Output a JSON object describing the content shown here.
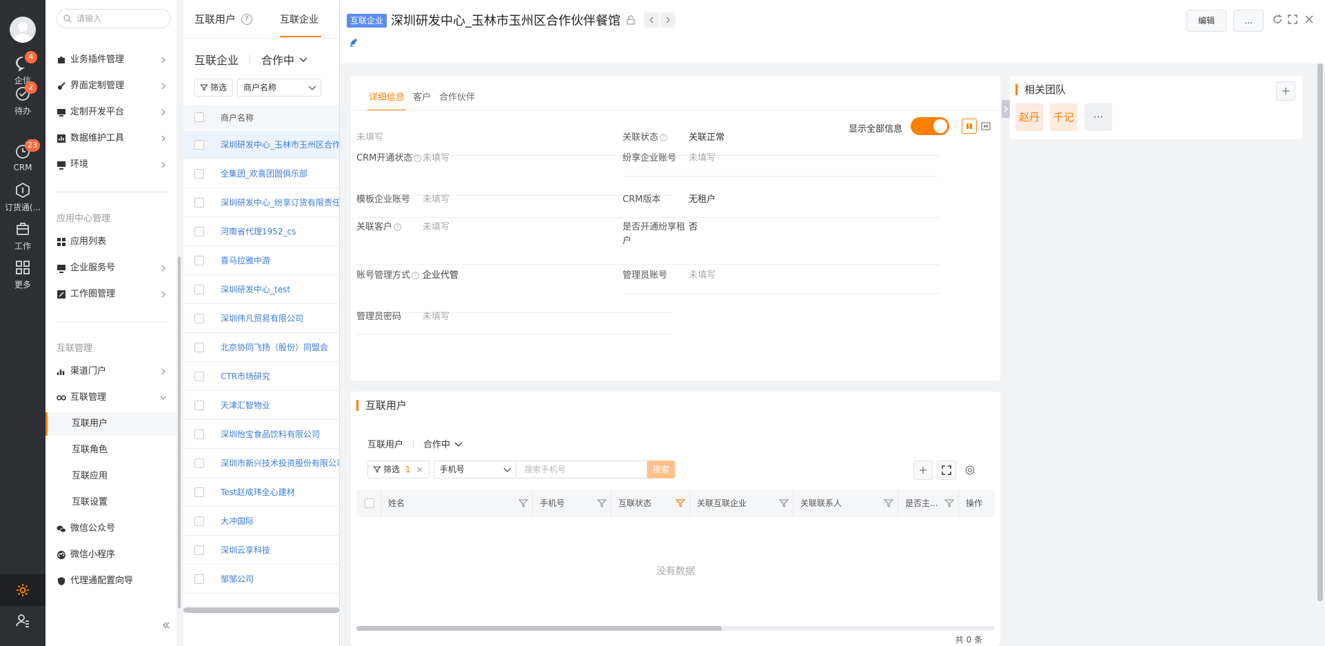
{
  "rail": {
    "items": [
      {
        "label": "企信",
        "badge": "4",
        "icon": "chat-bubble-icon"
      },
      {
        "label": "待办",
        "badge": "2",
        "icon": "check-circle-icon"
      },
      {
        "label": "CRM",
        "badge": "23",
        "icon": "clock-icon"
      },
      {
        "label": "订货通(...",
        "badge": "",
        "icon": "order-box-icon"
      },
      {
        "label": "工作",
        "badge": "",
        "icon": "briefcase-icon"
      },
      {
        "label": "更多",
        "badge": "",
        "icon": "grid-icon"
      }
    ]
  },
  "menu": {
    "search_placeholder": "请输入",
    "group1": [
      "业务插件管理",
      "界面定制管理",
      "定制开发平台",
      "数据维护工具",
      "环境"
    ],
    "section_app": "应用中心管理",
    "group2": [
      "应用列表",
      "企业服务号",
      "工作圈管理"
    ],
    "section_link": "互联管理",
    "channel_portal": "渠道门户",
    "link_mgmt": "互联管理",
    "link_sub": [
      "互联用户",
      "互联角色",
      "互联应用",
      "互联设置"
    ],
    "group3": [
      "微信公众号",
      "微信小程序",
      "代理通配置向导"
    ]
  },
  "list": {
    "tab_users": "互联用户",
    "tab_help": "?",
    "tab_enterprise": "互联企业",
    "scope_object": "互联企业",
    "scope_status": "合作中",
    "filter_label": "筛选",
    "filter_field": "商户名称",
    "col_name": "商户名称",
    "rows": [
      "深圳研发中心_玉林市玉州区合作伙伴餐馆",
      "全集团_欢喜团圆俱乐部",
      "深圳研发中心_纷享订货有限责任公司",
      "河南省代理1952_cs",
      "喜马拉雅中游",
      "深圳研发中心_test",
      "深圳伟凡贸易有限公司",
      "北京协同飞扬（股份）同盟会",
      "CTR市场研究",
      "天津汇智物业",
      "深圳怡宝食品饮料有限公司",
      "深圳市新兴技术投资股份有限公司",
      "Test赵成玮全心建材",
      "大冲国际",
      "深圳云享科技",
      "邹邹公司"
    ]
  },
  "detail": {
    "tag": "互联企业",
    "title": "深圳研发中心_玉林市玉州区合作伙伴餐馆",
    "edit_label": "编辑",
    "more_label": "...",
    "tabs": [
      "详细信息",
      "客户",
      "合作伙伴"
    ],
    "show_all_label": "显示全部信息",
    "fields_left": [
      {
        "k": "",
        "v": "未填写",
        "q": false
      },
      {
        "k": "CRM开通状态",
        "v": "未填写",
        "q": true
      },
      {
        "k": "模板企业账号",
        "v": "未填写",
        "q": false
      },
      {
        "k": "关联客户",
        "v": "未填写",
        "q": true
      },
      {
        "k": "账号管理方式",
        "v": "企业代管",
        "q": true
      },
      {
        "k": "管理员密码",
        "v": "未填写",
        "q": false
      }
    ],
    "fields_right": [
      {
        "k": "关联状态",
        "v": "关联正常",
        "q": true
      },
      {
        "k": "纷享企业账号",
        "v": "未填写",
        "q": false
      },
      {
        "k": "CRM版本",
        "v": "无租户",
        "q": false
      },
      {
        "k": "是否开通纷享租户",
        "v": "否",
        "q": false
      },
      {
        "k": "管理员账号",
        "v": "未填写",
        "q": false
      }
    ],
    "team_title": "相关团队",
    "team_members": [
      "赵丹",
      "千记"
    ],
    "team_more": "···",
    "users_title": "互联用户",
    "users_scope_object": "互联用户",
    "users_scope_status": "合作中",
    "users_filter_label": "筛选",
    "users_filter_count": "1",
    "users_filter_clear": "×",
    "users_field": "手机号",
    "users_search_placeholder": "搜索手机号",
    "users_search_btn": "搜索",
    "users_cols": [
      "姓名",
      "手机号",
      "互联状态",
      "关联互联企业",
      "关联联系人",
      "是否主...",
      "操作"
    ],
    "no_data": "没有数据",
    "total": "共 0 条"
  },
  "colors": {
    "accent": "#ff8000",
    "link": "#3b7ddd",
    "rail": "#2d2f33"
  }
}
